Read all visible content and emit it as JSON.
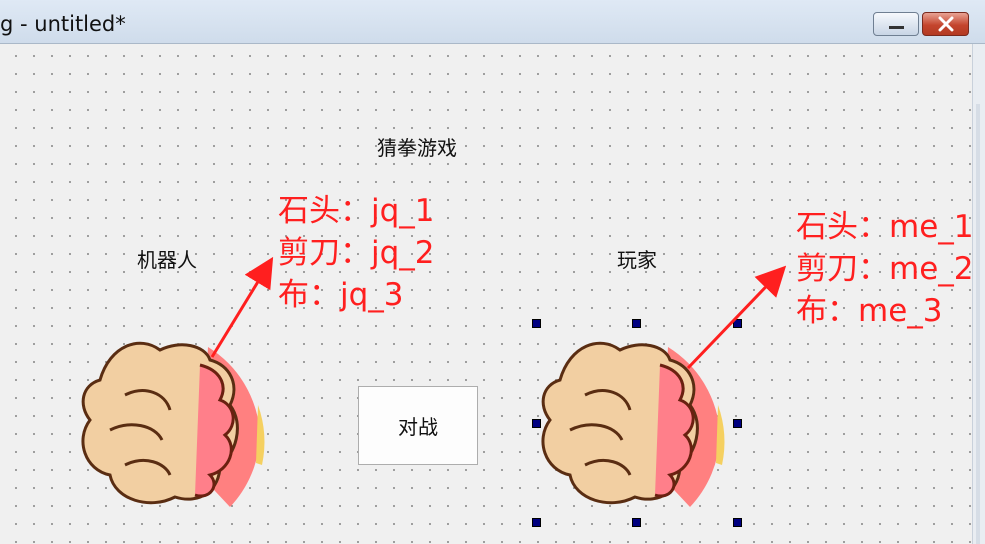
{
  "window": {
    "title": "g - untitled*"
  },
  "form": {
    "heading": "猜拳游戏",
    "robot_label": "机器人",
    "player_label": "玩家",
    "battle_button": "对战"
  },
  "annotations": {
    "robot": [
      "石头：jq_1",
      "剪刀：jq_2",
      "布：jq_3"
    ],
    "player": [
      "石头：me_1",
      "剪刀：me_2",
      "布：me_3"
    ]
  },
  "colors": {
    "annotation": "#ff1f1f",
    "selection_handle": "#000080",
    "glove": "#f2cfa2",
    "cuff": "#ff7f7f"
  },
  "icons": {
    "robot_hand": "fist-glove-icon",
    "player_hand": "fist-glove-icon"
  }
}
